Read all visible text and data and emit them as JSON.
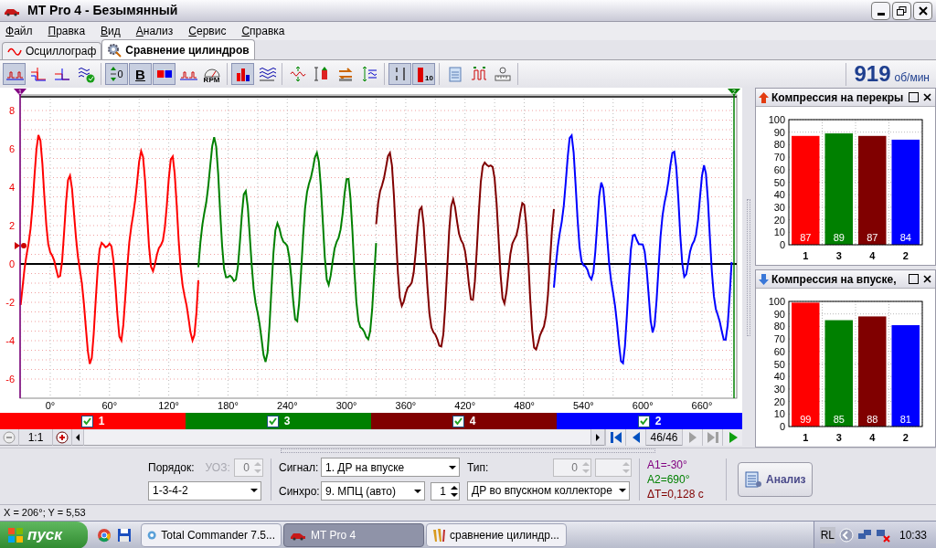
{
  "window": {
    "title": "MT Pro 4 - Безымянный"
  },
  "menu": [
    {
      "label": "Файл"
    },
    {
      "label": "Правка"
    },
    {
      "label": "Вид"
    },
    {
      "label": "Анализ"
    },
    {
      "label": "Сервис"
    },
    {
      "label": "Справка"
    }
  ],
  "tabs": [
    {
      "label": "Осциллограф",
      "selected": false,
      "kind": "wave"
    },
    {
      "label": "Сравнение цилиндров",
      "selected": true,
      "kind": "gear"
    }
  ],
  "toolbar": [
    [
      {
        "kind": "wave-split",
        "pressed": true
      },
      {
        "kind": "steps-a",
        "pressed": false
      },
      {
        "kind": "steps-b",
        "pressed": false
      },
      {
        "kind": "waves-check",
        "pressed": false
      }
    ],
    [
      {
        "kind": "zero",
        "text": "0",
        "pressed": true
      },
      {
        "kind": "bold",
        "text": "B",
        "pressed": true
      },
      {
        "kind": "one-two",
        "pressed": true
      },
      {
        "kind": "wave-split",
        "pressed": false
      },
      {
        "kind": "gauge",
        "text": "RPM",
        "pressed": false
      }
    ],
    [
      {
        "kind": "bars",
        "pressed": true
      },
      {
        "kind": "waves",
        "pressed": false
      }
    ],
    [
      {
        "kind": "updown-wave",
        "pressed": false
      },
      {
        "kind": "updown-bars",
        "pressed": false
      },
      {
        "kind": "swap",
        "pressed": false
      },
      {
        "kind": "updown-lines",
        "pressed": false
      }
    ],
    [
      {
        "kind": "one-zero",
        "pressed": true
      },
      {
        "kind": "bar-ten",
        "text": "10",
        "pressed": true
      }
    ],
    [
      {
        "kind": "calc",
        "pressed": false
      },
      {
        "kind": "pulses",
        "pressed": false
      },
      {
        "kind": "ruler",
        "pressed": false
      }
    ]
  ],
  "rpm": {
    "value": "919",
    "unit": "об/мин"
  },
  "oscillogram": {
    "y_ticks": [
      "8",
      "6",
      "4",
      "2",
      "0",
      "-2",
      "-4",
      "-6"
    ],
    "x_ticks": [
      "0°",
      "60°",
      "120°",
      "180°",
      "240°",
      "300°",
      "360°",
      "420°",
      "480°",
      "540°",
      "600°",
      "660°"
    ],
    "markers": [
      {
        "label": "1",
        "color": "#800080"
      },
      {
        "label": "2",
        "color": "#008000"
      }
    ]
  },
  "cylinders": [
    {
      "label": "1",
      "checked": true,
      "color": "#ff0000"
    },
    {
      "label": "3",
      "checked": true,
      "color": "#008000"
    },
    {
      "label": "4",
      "checked": true,
      "color": "#800000"
    },
    {
      "label": "2",
      "checked": true,
      "color": "#0000ff"
    }
  ],
  "navigation": {
    "scale": "1:1",
    "counter": "46/46",
    "buttons": [
      {
        "kind": "first",
        "disabled": false
      },
      {
        "kind": "prev",
        "disabled": false
      },
      {
        "kind": "next",
        "disabled": true
      },
      {
        "kind": "last",
        "disabled": true
      },
      {
        "kind": "play",
        "disabled": false
      }
    ]
  },
  "panels": [
    {
      "title": "Компрессия на перекры",
      "kind": "up",
      "chart_data": {
        "type": "bar",
        "categories": [
          "1",
          "3",
          "4",
          "2"
        ],
        "ylim": [
          0,
          100
        ],
        "yticks": [
          0,
          10,
          20,
          30,
          40,
          50,
          60,
          70,
          80,
          90,
          100
        ],
        "grid": true,
        "data_labels": true,
        "series": [
          {
            "color": "#ff0000",
            "values": [
              87,
              null,
              null,
              null
            ]
          },
          {
            "color": "#008000",
            "values": [
              null,
              89,
              null,
              null
            ]
          },
          {
            "color": "#800000",
            "values": [
              null,
              null,
              87,
              null
            ]
          },
          {
            "color": "#0000ff",
            "values": [
              null,
              null,
              null,
              84
            ]
          }
        ]
      }
    },
    {
      "title": "Компрессия на впуске,",
      "kind": "down",
      "chart_data": {
        "type": "bar",
        "categories": [
          "1",
          "3",
          "4",
          "2"
        ],
        "ylim": [
          0,
          100
        ],
        "yticks": [
          0,
          10,
          20,
          30,
          40,
          50,
          60,
          70,
          80,
          90,
          100
        ],
        "grid": true,
        "data_labels": true,
        "series": [
          {
            "color": "#ff0000",
            "values": [
              99,
              null,
              null,
              null
            ]
          },
          {
            "color": "#008000",
            "values": [
              null,
              85,
              null,
              null
            ]
          },
          {
            "color": "#800000",
            "values": [
              null,
              null,
              88,
              null
            ]
          },
          {
            "color": "#0000ff",
            "values": [
              null,
              null,
              null,
              81
            ]
          }
        ]
      }
    }
  ],
  "controls": {
    "order_label": "Порядок:",
    "uoz_label": "УОЗ:",
    "uoz_value": "0",
    "uoz_disabled": true,
    "order_value": "1-3-4-2",
    "signal_label": "Сигнал:",
    "signal_value": "1. ДР на впуске",
    "sync_label": "Синхро:",
    "sync_value": "9. МПЦ (авто)",
    "sync_spin": "1",
    "type_label": "Тип:",
    "type_spin": "0",
    "type_disabled": true,
    "type_value": "ДР во впускном коллекторе"
  },
  "readouts": [
    {
      "text": "A1=-30°",
      "color": "#800080"
    },
    {
      "text": "A2=690°",
      "color": "#008000"
    },
    {
      "text": "ΔT=0,128 с",
      "color": "#800000"
    }
  ],
  "analyze_button": "Анализ",
  "status_bar": "X = 206°; Y = 5,53",
  "taskbar": {
    "start": "пуск",
    "tasks": [
      {
        "label": "Total Commander 7.5...",
        "selected": false,
        "kind": "tc"
      },
      {
        "label": "MT Pro 4",
        "selected": true,
        "kind": "car"
      },
      {
        "label": "сравнение цилиндр...",
        "selected": false,
        "kind": "doc"
      }
    ],
    "lang": "RL",
    "time": "10:33"
  }
}
